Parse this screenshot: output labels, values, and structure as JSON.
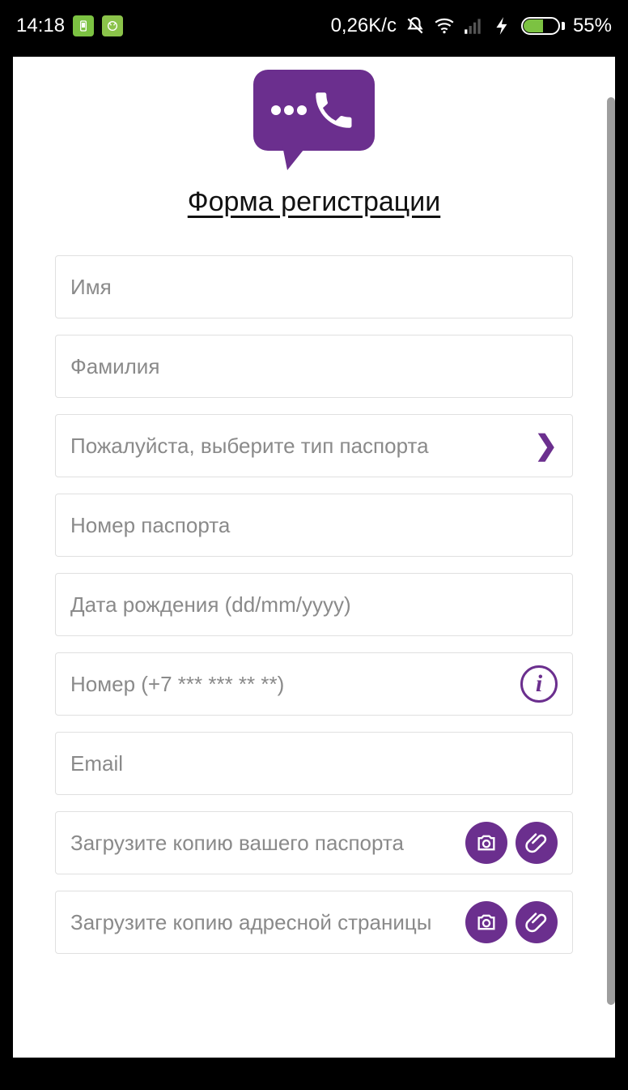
{
  "status": {
    "time": "14:18",
    "speed": "0,26K/c",
    "battery_pct": "55%"
  },
  "page": {
    "title": "Форма регистрации"
  },
  "fields": {
    "first_name": "Имя",
    "last_name": "Фамилия",
    "passport_type": "Пожалуйста, выберите тип паспорта",
    "passport_number": "Номер паспорта",
    "dob": "Дата рождения (dd/mm/yyyy)",
    "phone": "Номер (+7 *** *** ** **)",
    "email": "Email",
    "upload_passport": "Загрузите копию вашего паспорта",
    "upload_address": "Загрузите копию адресной страницы"
  },
  "colors": {
    "accent": "#6b2f8e"
  }
}
